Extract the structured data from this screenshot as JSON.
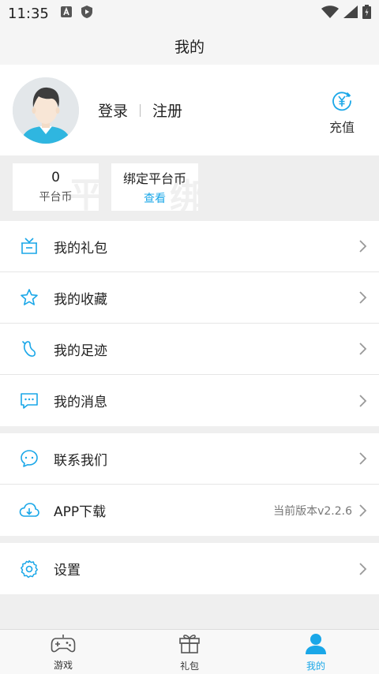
{
  "status_bar": {
    "time": "11:35"
  },
  "header": {
    "title": "我的"
  },
  "profile": {
    "login_label": "登录",
    "register_label": "注册",
    "recharge_label": "充值"
  },
  "coins": {
    "platform": {
      "value": "0",
      "label": "平台币"
    },
    "bound": {
      "title": "绑定平台币",
      "link_label": "查看"
    }
  },
  "menu": {
    "gift": {
      "label": "我的礼包",
      "icon": "gift-box-icon"
    },
    "favorites": {
      "label": "我的收藏",
      "icon": "star-icon"
    },
    "footprint": {
      "label": "我的足迹",
      "icon": "footprint-icon"
    },
    "messages": {
      "label": "我的消息",
      "icon": "message-icon"
    },
    "contact": {
      "label": "联系我们",
      "icon": "chat-icon"
    },
    "download": {
      "label": "APP下载",
      "icon": "cloud-download-icon",
      "version_text": "当前版本v2.2.6"
    },
    "settings": {
      "label": "设置",
      "icon": "gear-icon"
    }
  },
  "tabs": {
    "games": {
      "label": "游戏",
      "icon": "gamepad-icon"
    },
    "gifts": {
      "label": "礼包",
      "icon": "gift-icon"
    },
    "mine": {
      "label": "我的",
      "icon": "user-icon",
      "active": true
    }
  },
  "colors": {
    "accent": "#1aa7e8",
    "background": "#efefef"
  }
}
